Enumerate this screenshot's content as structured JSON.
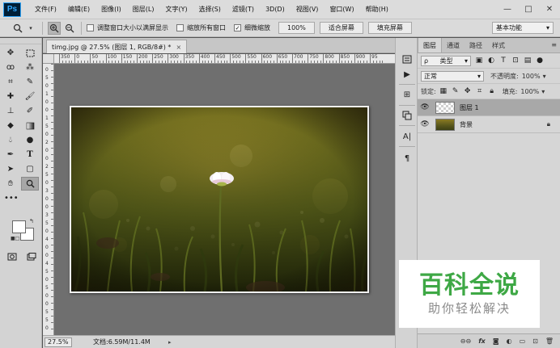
{
  "app": {
    "logo": "Ps",
    "menus": [
      "文件(F)",
      "编辑(E)",
      "图像(I)",
      "图层(L)",
      "文字(Y)",
      "选择(S)",
      "滤镜(T)",
      "3D(D)",
      "视图(V)",
      "窗口(W)",
      "帮助(H)"
    ],
    "window_controls": {
      "minimize": "—",
      "maximize": "□",
      "close": "✕"
    }
  },
  "options_bar": {
    "tool_icon": "zoom-icon",
    "checkboxes": [
      {
        "label": "调整窗口大小以满屏显示",
        "checked": false
      },
      {
        "label": "缩放所有窗口",
        "checked": false
      },
      {
        "label": "细微缩放",
        "checked": true
      }
    ],
    "zoom_percent_button": "100%",
    "fit_screen_button": "适合屏幕",
    "fill_screen_button": "填充屏幕",
    "workspace": "基本功能"
  },
  "document": {
    "tab_title": "timg.jpg @ 27.5% (图层 1, RGB/8#) *",
    "close": "×",
    "zoom": "27.5%",
    "doc_size": "文档:6.59M/11.4M",
    "ruler_top_labels": [
      "350",
      "0",
      "50",
      "100",
      "150",
      "200",
      "250",
      "300",
      "350",
      "400",
      "450",
      "500",
      "550",
      "600",
      "650",
      "700",
      "750",
      "800",
      "850",
      "900",
      "95"
    ],
    "ruler_left_labels": [
      "0",
      "5",
      "0",
      "1",
      "0",
      "0",
      "1",
      "5",
      "0",
      "2",
      "0",
      "0",
      "2",
      "5",
      "0",
      "3",
      "0",
      "0",
      "3",
      "5",
      "0",
      "4",
      "0",
      "0",
      "4",
      "5",
      "0",
      "5",
      "0",
      "0",
      "5",
      "5",
      "0"
    ]
  },
  "layers_panel": {
    "tabs": [
      "图层",
      "通道",
      "路径",
      "样式"
    ],
    "filter_kind": "类型",
    "blend_mode": "正常",
    "opacity_label": "不透明度:",
    "opacity_value": "100%",
    "lock_label": "锁定:",
    "fill_label": "填充:",
    "fill_value": "100%",
    "layers": [
      {
        "name": "图层 1",
        "selected": true,
        "visible": true,
        "locked": false,
        "thumb": "transparent"
      },
      {
        "name": "背景",
        "selected": false,
        "visible": true,
        "locked": true,
        "thumb": "photo"
      }
    ],
    "footer_icons": [
      "link-icon",
      "fx-icon",
      "mask-icon",
      "adjustment-icon",
      "group-icon",
      "new-layer-icon",
      "delete-icon"
    ],
    "footer_fx": "fx"
  },
  "watermark": {
    "title": "百科全说",
    "subtitle": "助你轻松解决"
  },
  "colors": {
    "foreground": "#ffffff",
    "background": "#ffffff",
    "watermark_green": "#3ea845"
  }
}
